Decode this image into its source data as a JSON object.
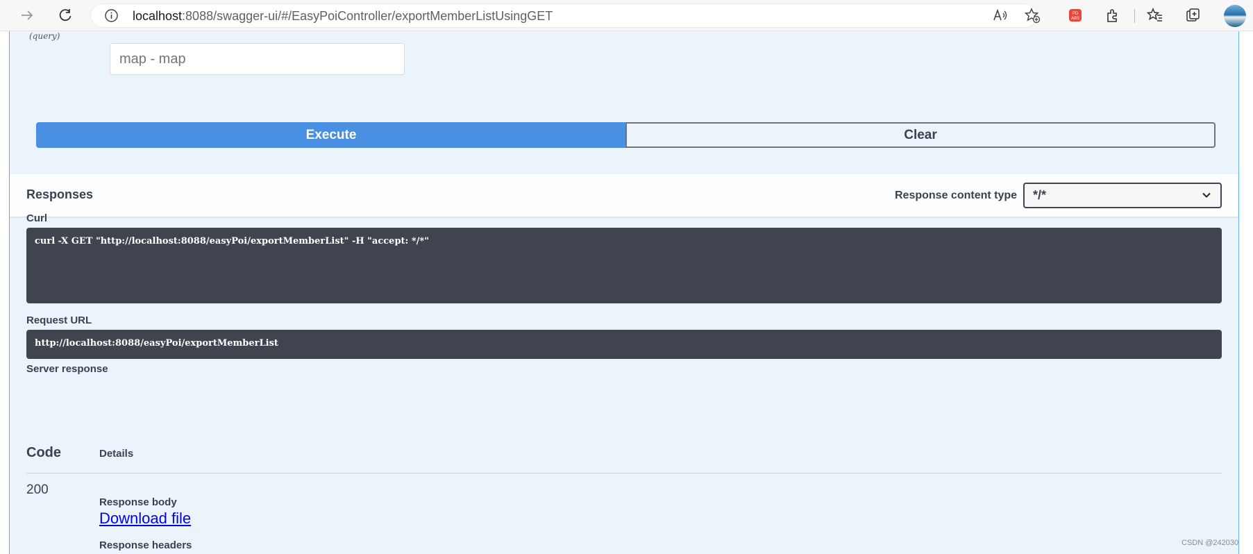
{
  "browser": {
    "url_host": "localhost",
    "url_rest": ":8088/swagger-ui/#/EasyPoiController/exportMemberListUsingGET"
  },
  "params": {
    "in_label": "(query)",
    "input_placeholder": "map - map"
  },
  "actions": {
    "execute_label": "Execute",
    "clear_label": "Clear"
  },
  "responses": {
    "title": "Responses",
    "content_type_label": "Response content type",
    "content_type_value": "*/*"
  },
  "curl": {
    "label": "Curl",
    "command": "curl -X GET \"http://localhost:8088/easyPoi/exportMemberList\" -H \"accept: */*\""
  },
  "request_url": {
    "label": "Request URL",
    "value": "http://localhost:8088/easyPoi/exportMemberList"
  },
  "server_response": {
    "label": "Server response",
    "col_code": "Code",
    "col_details": "Details",
    "status_code": "200",
    "body_label": "Response body",
    "download_label": "Download file",
    "headers_label": "Response headers"
  },
  "watermark": "CSDN @242030"
}
